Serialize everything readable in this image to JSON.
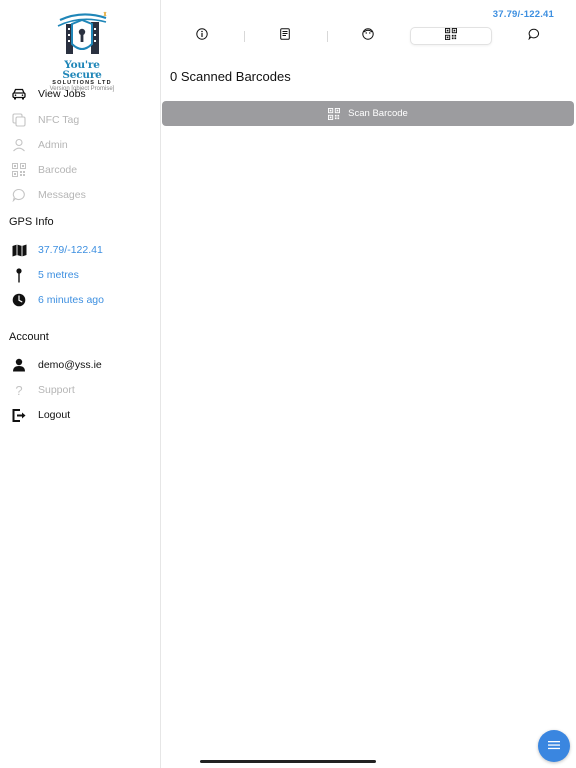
{
  "logo": {
    "title": "You're Secure",
    "subtitle": "SOLUTIONS LTD",
    "version": "Version [object Promise]"
  },
  "sidebar": {
    "items": [
      {
        "label": "View Jobs",
        "icon": "car-icon",
        "enabled": true
      },
      {
        "label": "NFC Tag",
        "icon": "nfc-icon",
        "enabled": false
      },
      {
        "label": "Admin",
        "icon": "person-icon",
        "enabled": false
      },
      {
        "label": "Barcode",
        "icon": "qr-code-icon",
        "enabled": false
      },
      {
        "label": "Messages",
        "icon": "chat-bubble-icon",
        "enabled": false
      }
    ]
  },
  "gps": {
    "title": "GPS Info",
    "coordinates": "37.79/-122.41",
    "accuracy": "5 metres",
    "updated": "6 minutes ago"
  },
  "account": {
    "title": "Account",
    "email": "demo@yss.ie",
    "support": "Support",
    "logout": "Logout"
  },
  "header": {
    "coordinates": "37.79/-122.41"
  },
  "tabs": [
    {
      "icon": "info-icon",
      "active": false
    },
    {
      "icon": "document-icon",
      "active": false
    },
    {
      "icon": "face-icon",
      "active": false
    },
    {
      "icon": "qr-code-icon",
      "active": true
    },
    {
      "icon": "chat-bubble-icon",
      "active": false
    }
  ],
  "main": {
    "scanned_title": "0 Scanned Barcodes",
    "scan_button_label": "Scan Barcode"
  },
  "colors": {
    "accent": "#3d8fe0",
    "button_grey": "#9c9c9f",
    "fab": "#3a86e0",
    "logo_blue": "#1f86b8"
  }
}
